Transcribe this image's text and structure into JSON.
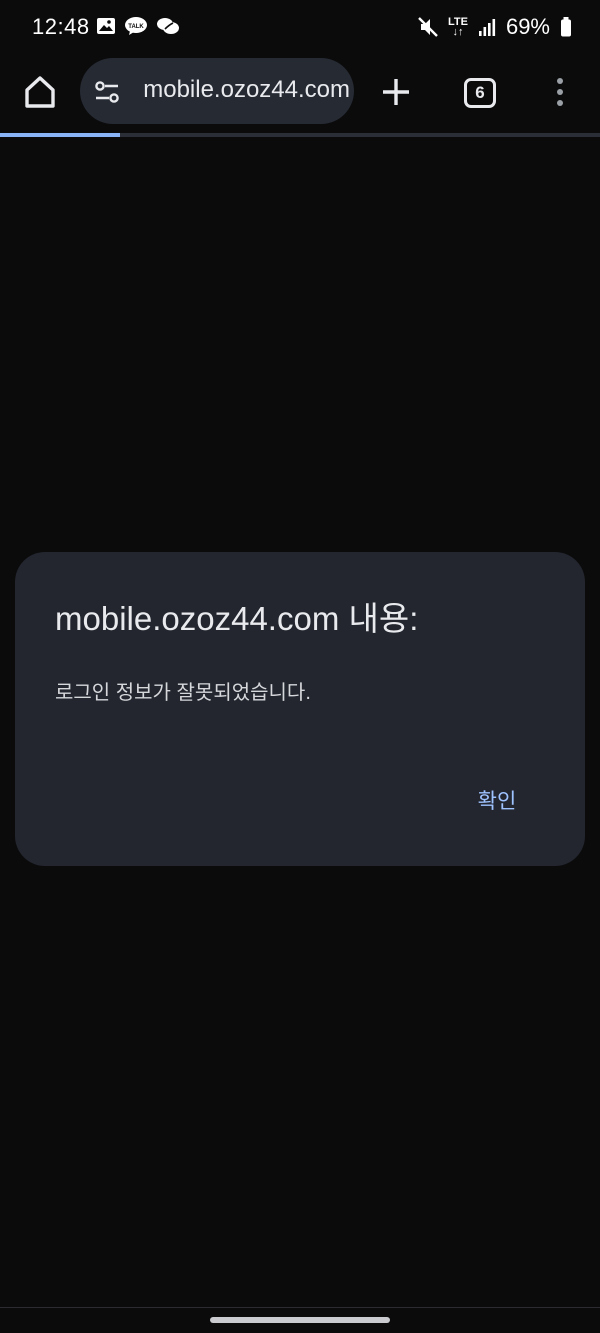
{
  "status_bar": {
    "time": "12:48",
    "network": "LTE",
    "battery": "69%",
    "icons": [
      "image-notification-icon",
      "kakaotalk-icon",
      "chat-bubble-icon",
      "mute-icon",
      "signal-icon",
      "battery-icon"
    ]
  },
  "toolbar": {
    "url": "mobile.ozoz44.com",
    "tab_count": "6",
    "icons": [
      "home-icon",
      "tune-icon",
      "plus-icon",
      "more-vert-icon"
    ]
  },
  "page": {
    "progress_fraction": 0.2
  },
  "dialog": {
    "title": "mobile.ozoz44.com 내용:",
    "message": "로그인 정보가 잘못되었습니다.",
    "ok_label": "확인"
  },
  "colors": {
    "background": "#0b0b0c",
    "dialog": "#23262f",
    "omnibox": "#262a33",
    "accent": "#8ab4f8",
    "button_text": "#9fc3ff"
  }
}
